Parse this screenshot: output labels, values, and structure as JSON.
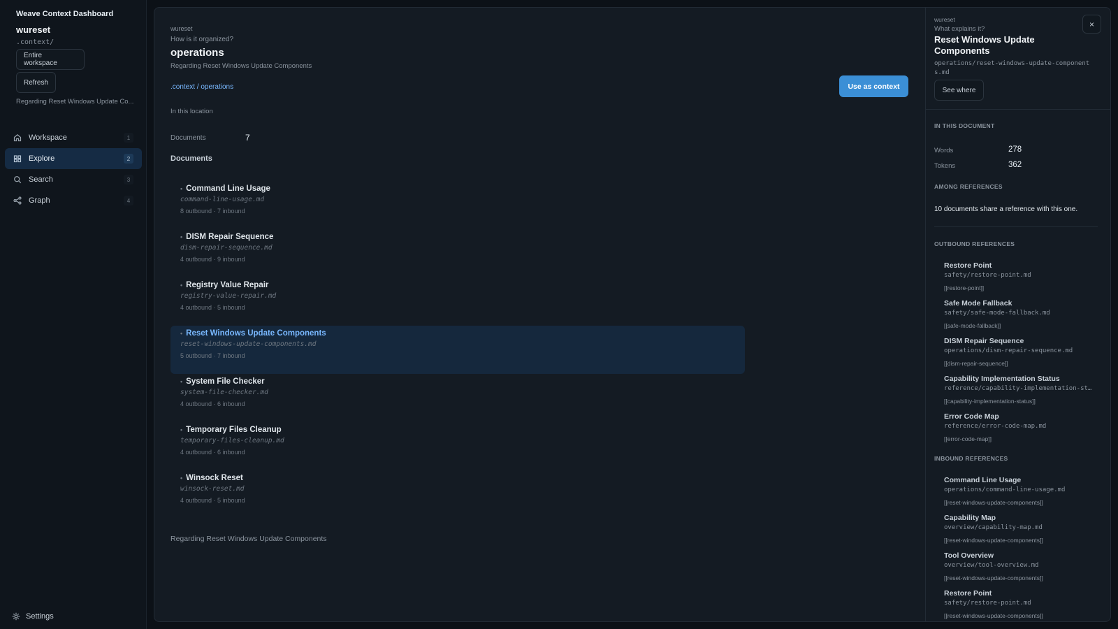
{
  "sidebar": {
    "app_title": "Weave Context Dashboard",
    "workspace_name": "wureset",
    "workspace_path": ".context/",
    "entire_workspace_label": "Entire workspace",
    "refresh_label": "Refresh",
    "context_text": "Regarding Reset Windows Update Co...",
    "nav": [
      {
        "label": "Workspace",
        "count": "1",
        "icon": "home-icon"
      },
      {
        "label": "Explore",
        "count": "2",
        "icon": "grid-icon",
        "active": true
      },
      {
        "label": "Search",
        "count": "3",
        "icon": "search-icon"
      },
      {
        "label": "Graph",
        "count": "4",
        "icon": "graph-icon"
      }
    ],
    "settings_label": "Settings"
  },
  "main": {
    "kicker": "wureset",
    "question": "How is it organized?",
    "title": "operations",
    "subtitle": "Regarding Reset Windows Update Components",
    "breadcrumb": {
      "root": ".context",
      "sep": " / ",
      "current": "operations"
    },
    "use_context_label": "Use as context",
    "in_location": "In this location",
    "documents_label": "Documents",
    "documents_count": "7",
    "documents_heading": "Documents",
    "documents": [
      {
        "title": "Command Line Usage",
        "file": "command-line-usage.md",
        "meta": "8 outbound · 7 inbound"
      },
      {
        "title": "DISM Repair Sequence",
        "file": "dism-repair-sequence.md",
        "meta": "4 outbound · 9 inbound"
      },
      {
        "title": "Registry Value Repair",
        "file": "registry-value-repair.md",
        "meta": "4 outbound · 5 inbound"
      },
      {
        "title": "Reset Windows Update Components",
        "file": "reset-windows-update-components.md",
        "meta": "5 outbound · 7 inbound",
        "active": true
      },
      {
        "title": "System File Checker",
        "file": "system-file-checker.md",
        "meta": "4 outbound · 6 inbound"
      },
      {
        "title": "Temporary Files Cleanup",
        "file": "temporary-files-cleanup.md",
        "meta": "4 outbound · 6 inbound"
      },
      {
        "title": "Winsock Reset",
        "file": "winsock-reset.md",
        "meta": "4 outbound · 5 inbound"
      }
    ],
    "footer": "Regarding Reset Windows Update Components"
  },
  "detail": {
    "kicker": "wureset",
    "question": "What explains it?",
    "title": "Reset Windows Update Components",
    "path": "operations/reset-windows-update-components.md",
    "see_where_label": "See where",
    "close_label": "×",
    "in_document_heading": "IN THIS DOCUMENT",
    "words_label": "Words",
    "words_value": "278",
    "tokens_label": "Tokens",
    "tokens_value": "362",
    "among_heading": "AMONG REFERENCES",
    "among_text": "10 documents share a reference with this one.",
    "outbound_heading": "OUTBOUND REFERENCES",
    "outbound": [
      {
        "title": "Restore Point",
        "path": "safety/restore-point.md",
        "link": "[[restore-point]]"
      },
      {
        "title": "Safe Mode Fallback",
        "path": "safety/safe-mode-fallback.md",
        "link": "[[safe-mode-fallback]]"
      },
      {
        "title": "DISM Repair Sequence",
        "path": "operations/dism-repair-sequence.md",
        "link": "[[dism-repair-sequence]]"
      },
      {
        "title": "Capability Implementation Status",
        "path": "reference/capability-implementation-status.md",
        "link": "[[capability-implementation-status]]"
      },
      {
        "title": "Error Code Map",
        "path": "reference/error-code-map.md",
        "link": "[[error-code-map]]"
      }
    ],
    "inbound_heading": "INBOUND REFERENCES",
    "inbound": [
      {
        "title": "Command Line Usage",
        "path": "operations/command-line-usage.md",
        "link": "[[reset-windows-update-components]]"
      },
      {
        "title": "Capability Map",
        "path": "overview/capability-map.md",
        "link": "[[reset-windows-update-components]]"
      },
      {
        "title": "Tool Overview",
        "path": "overview/tool-overview.md",
        "link": "[[reset-windows-update-components]]"
      },
      {
        "title": "Restore Point",
        "path": "safety/restore-point.md",
        "link": "[[reset-windows-update-components]]"
      }
    ]
  }
}
